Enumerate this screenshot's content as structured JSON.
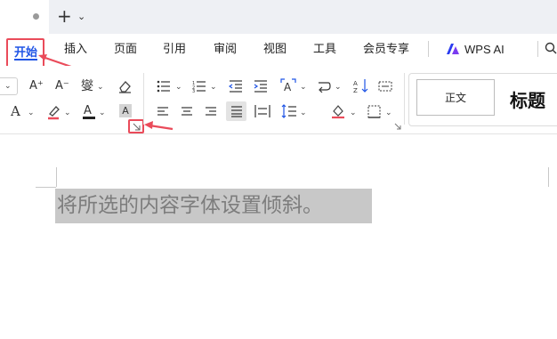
{
  "tabs": {
    "start": "开始",
    "insert": "插入",
    "page": "页面",
    "reference": "引用",
    "review": "审阅",
    "view": "视图",
    "tools": "工具",
    "member": "会员专享",
    "wps_ai": "WPS AI"
  },
  "toolbar": {
    "font_increase": "A⁺",
    "font_decrease": "A⁻",
    "phonetic": "燮",
    "clear_format": "⌫",
    "text_effect": "A",
    "highlight": "✎",
    "font_color": "A",
    "char_shading": "A"
  },
  "styles": {
    "normal": "正文",
    "heading": "标题"
  },
  "document": {
    "selected_text": "将所选的内容字体设置倾斜。"
  },
  "colors": {
    "accent": "#1f54e6",
    "annotation": "#ea4b5a",
    "selection": "#c8c8c8"
  }
}
